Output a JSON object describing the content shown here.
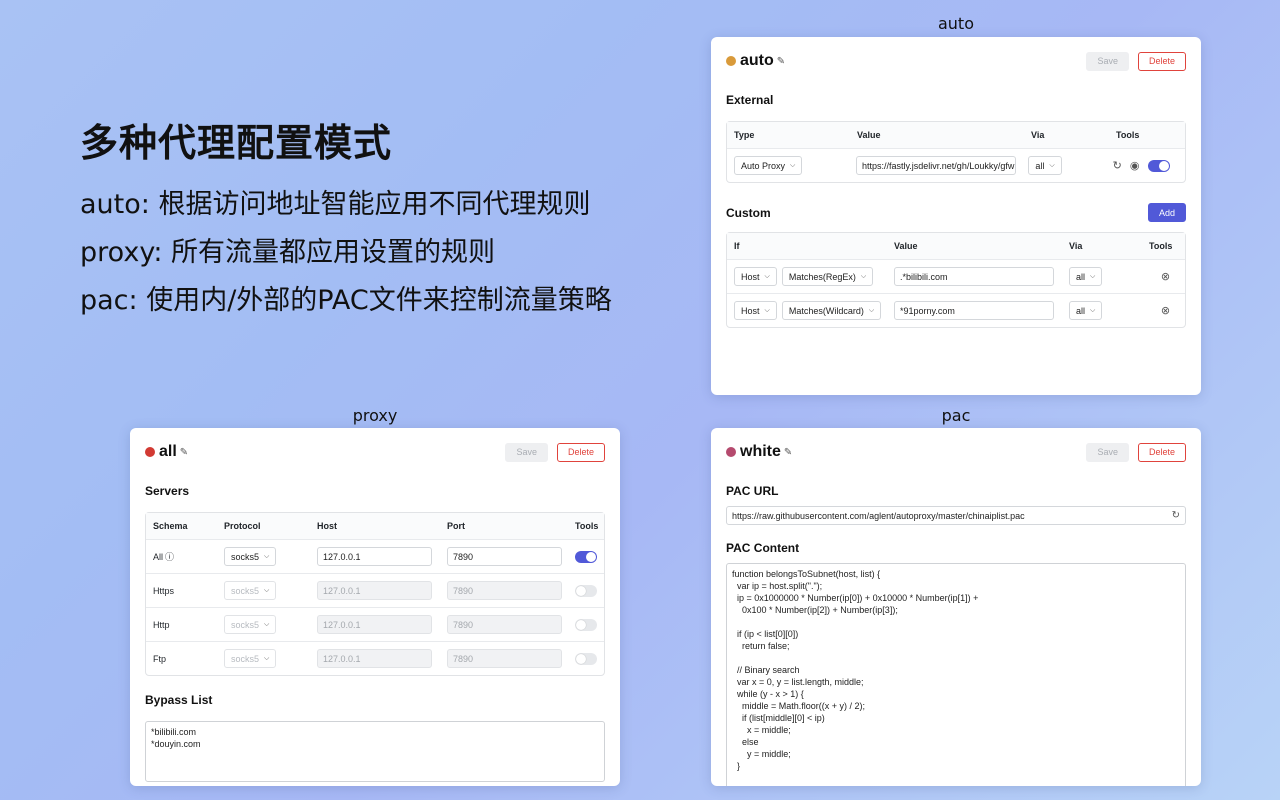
{
  "hero": {
    "title": "多种代理配置模式",
    "lines": [
      "auto: 根据访问地址智能应用不同代理规则",
      "proxy: 所有流量都应用设置的规则",
      "pac: 使用内/外部的PAC文件来控制流量策略"
    ]
  },
  "captions": {
    "auto": "auto",
    "proxy": "proxy",
    "pac": "pac"
  },
  "common": {
    "save": "Save",
    "delete": "Delete",
    "add": "Add",
    "edit_glyph": "✎",
    "chev": "⌵"
  },
  "auto": {
    "name": "auto",
    "color": "#d99a3a",
    "external": {
      "title": "External",
      "headers": [
        "Type",
        "Value",
        "Via",
        "Tools"
      ],
      "row": {
        "type": "Auto Proxy",
        "value": "https://fastly.jsdelivr.net/gh/Loukky/gfwl",
        "via": "all"
      }
    },
    "custom": {
      "title": "Custom",
      "headers": [
        "If",
        "Value",
        "Via",
        "Tools"
      ],
      "rows": [
        {
          "field": "Host",
          "match": "Matches(RegEx)",
          "value": ".*bilibili.com",
          "via": "all"
        },
        {
          "field": "Host",
          "match": "Matches(Wildcard)",
          "value": "*91porny.com",
          "via": "all"
        }
      ]
    }
  },
  "proxy": {
    "name": "all",
    "color": "#d23a33",
    "servers": {
      "title": "Servers",
      "headers": [
        "Schema",
        "Protocol",
        "Host",
        "Port",
        "Tools"
      ],
      "rows": [
        {
          "schema": "All",
          "protocol": "socks5",
          "host": "127.0.0.1",
          "port": "7890",
          "enabled": true
        },
        {
          "schema": "Https",
          "protocol": "socks5",
          "host": "127.0.0.1",
          "port": "7890",
          "enabled": false
        },
        {
          "schema": "Http",
          "protocol": "socks5",
          "host": "127.0.0.1",
          "port": "7890",
          "enabled": false
        },
        {
          "schema": "Ftp",
          "protocol": "socks5",
          "host": "127.0.0.1",
          "port": "7890",
          "enabled": false
        }
      ]
    },
    "bypass": {
      "title": "Bypass List",
      "content": "*bilibili.com\n*douyin.com"
    }
  },
  "pac": {
    "name": "white",
    "color": "#b54a6e",
    "url_title": "PAC URL",
    "url": "https://raw.githubusercontent.com/aglent/autoproxy/master/chinaiplist.pac",
    "content_title": "PAC Content",
    "content": "function belongsToSubnet(host, list) {\n  var ip = host.split(\".\");\n  ip = 0x1000000 * Number(ip[0]) + 0x10000 * Number(ip[1]) +\n    0x100 * Number(ip[2]) + Number(ip[3]);\n\n  if (ip < list[0][0])\n    return false;\n\n  // Binary search\n  var x = 0, y = list.length, middle;\n  while (y - x > 1) {\n    middle = Math.floor((x + y) / 2);\n    if (list[middle][0] < ip)\n      x = middle;\n    else\n      y = middle;\n  }\n\n  // Match"
  }
}
